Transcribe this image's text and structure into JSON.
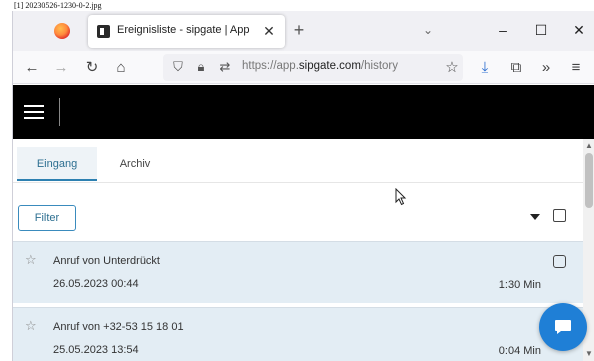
{
  "caption": "[1] 20230526-1230-0-2.jpg",
  "browser": {
    "tab_title": "Ereignisliste - sipgate | App",
    "url_prefix": "https://app.",
    "url_host": "sipgate.com",
    "url_path": "/history",
    "icons": [
      "firefox-logo",
      "close-icon",
      "plus-icon",
      "chevron-down-icon",
      "minimize-icon",
      "maximize-icon",
      "close-icon",
      "back-icon",
      "forward-icon",
      "reload-icon",
      "home-icon",
      "shield-icon",
      "lock-icon",
      "permissions-icon",
      "star-icon",
      "download-icon",
      "extensions-icon",
      "overflow-icon",
      "menu-icon"
    ]
  },
  "app": {
    "tabs": [
      {
        "label": "Eingang",
        "active": true
      },
      {
        "label": "Archiv",
        "active": false
      }
    ],
    "filter_label": "Filter",
    "events": [
      {
        "title": "Anruf von Unterdrückt",
        "date": "26.05.2023 00:44",
        "duration": "1:30 Min"
      },
      {
        "title": "Anruf von +32-53 15 18 01",
        "date": "25.05.2023 13:54",
        "duration": "0:04 Min"
      }
    ]
  },
  "colors": {
    "accent": "#2d80b1",
    "header_bg": "#000000",
    "row_bg": "#e3edf4",
    "chat_button": "#1f7fd6"
  }
}
